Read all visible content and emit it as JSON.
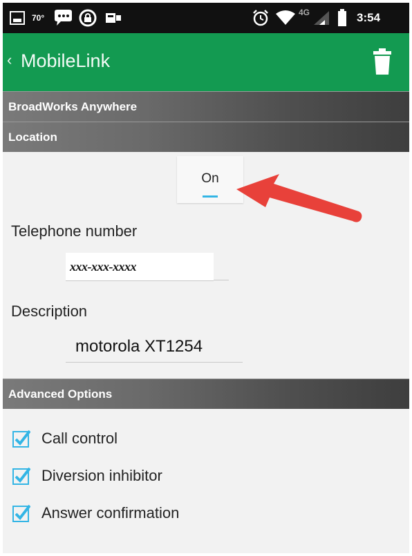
{
  "status_bar": {
    "temperature": "70°",
    "network_label": "4G",
    "time": "3:54"
  },
  "app_bar": {
    "back_icon": "chevron-left-icon",
    "title": "MobileLink",
    "trash_icon": "trash-icon"
  },
  "sections": {
    "broadworks": "BroadWorks Anywhere",
    "location": "Location",
    "advanced": "Advanced Options"
  },
  "location": {
    "toggle_label": "On",
    "telephone_label": "Telephone number",
    "telephone_value": "xxx-xxx-xxxx",
    "description_label": "Description",
    "description_value": "motorola XT1254"
  },
  "advanced_options": [
    {
      "label": "Call control",
      "checked": true
    },
    {
      "label": "Diversion inhibitor",
      "checked": true
    },
    {
      "label": "Answer confirmation",
      "checked": true
    }
  ],
  "colors": {
    "app_bar": "#139a51",
    "status_bar": "#111111",
    "checkbox": "#33b5e5",
    "annotation_arrow": "#e8413a"
  }
}
